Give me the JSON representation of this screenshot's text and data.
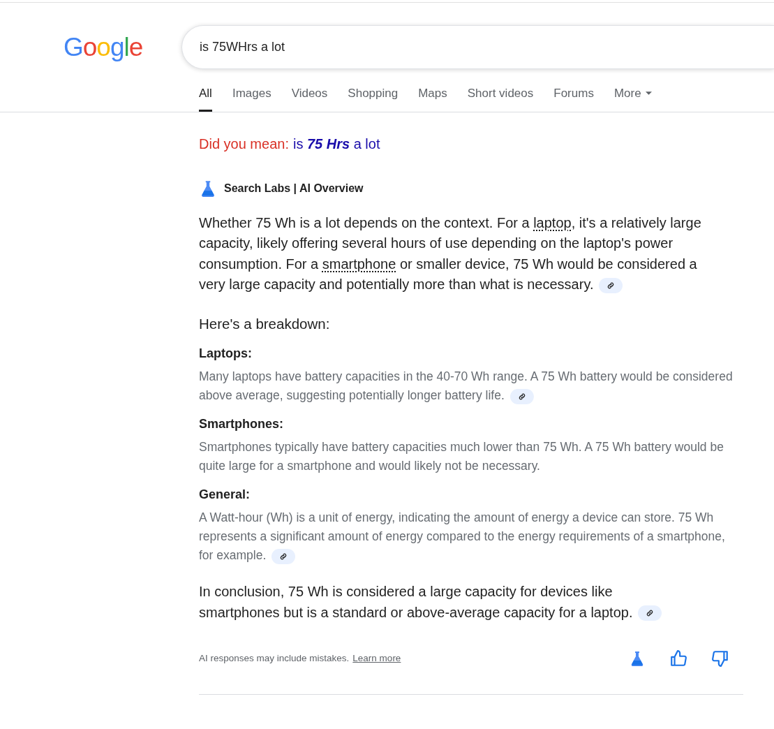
{
  "logo": "Google",
  "search": {
    "value": "is 75WHrs a lot"
  },
  "tabs": [
    {
      "label": "All",
      "selected": true
    },
    {
      "label": "Images",
      "selected": false
    },
    {
      "label": "Videos",
      "selected": false
    },
    {
      "label": "Shopping",
      "selected": false
    },
    {
      "label": "Maps",
      "selected": false
    },
    {
      "label": "Short videos",
      "selected": false
    },
    {
      "label": "Forums",
      "selected": false
    },
    {
      "label": "More",
      "selected": false,
      "kind": "menu"
    }
  ],
  "did_you_mean": {
    "label": "Did you mean:",
    "suggestion": "is **75 Hrs** a lot"
  },
  "ai_overview": {
    "title": "Search Labs | AI Overview",
    "intro": [
      {
        "kind": "text",
        "text": "Whether 75 Wh is a lot depends on the context. For a "
      },
      {
        "kind": "link",
        "text": "laptop"
      },
      {
        "kind": "text",
        "text": ", it's a relatively large capacity, likely offering several hours of use depending on the laptop's power consumption. For a "
      },
      {
        "kind": "link",
        "text": "smartphone"
      },
      {
        "kind": "text",
        "text": " or smaller device, 75 Wh would be considered a very large capacity and potentially more than what is necessary."
      }
    ],
    "intro_source": true,
    "breakdown_heading": "Here's a breakdown:",
    "items": [
      {
        "title": "Laptops:",
        "text": "Many laptops have battery capacities in the 40-70 Wh range. A 75 Wh battery would be considered above average, suggesting potentially longer battery life.",
        "source": true
      },
      {
        "title": "Smartphones:",
        "text": "Smartphones typically have battery capacities much lower than 75 Wh. A 75 Wh battery would be quite large for a smartphone and would likely not be necessary.",
        "source": false
      },
      {
        "title": "General:",
        "text": "A Watt-hour (Wh) is a unit of energy, indicating the amount of energy a device can store. 75 Wh represents a significant amount of energy compared to the energy requirements of a smartphone, for example.",
        "source": true
      }
    ],
    "conclusion": "In conclusion, 75 Wh is considered a large capacity for devices like smartphones but is a standard or above-average capacity for a laptop.",
    "conclusion_source": true,
    "disclaimer": "AI responses may include mistakes.",
    "learn_more": "Learn more"
  }
}
